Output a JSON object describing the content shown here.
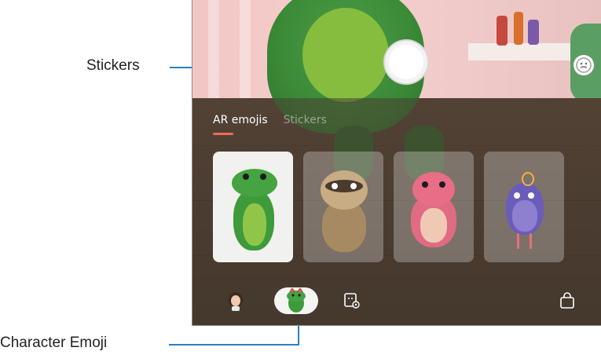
{
  "panel": {
    "tabs": [
      {
        "label": "AR emojis",
        "active": true
      },
      {
        "label": "Stickers",
        "active": false
      }
    ]
  },
  "cards": [
    {
      "name": "frog",
      "selected": true
    },
    {
      "name": "sloth",
      "selected": false
    },
    {
      "name": "pink-monster",
      "selected": false
    },
    {
      "name": "bird",
      "selected": false
    }
  ],
  "bottom_bar": {
    "icons": [
      "avatar-icon",
      "character-emoji-icon",
      "sticker-settings-icon",
      "store-bag-icon"
    ]
  },
  "callouts": {
    "stickers": "Stickers",
    "character_emoji": "Character Emoji"
  },
  "colors": {
    "accent": "#f06a5a",
    "callout_line": "#2b7fc2"
  }
}
